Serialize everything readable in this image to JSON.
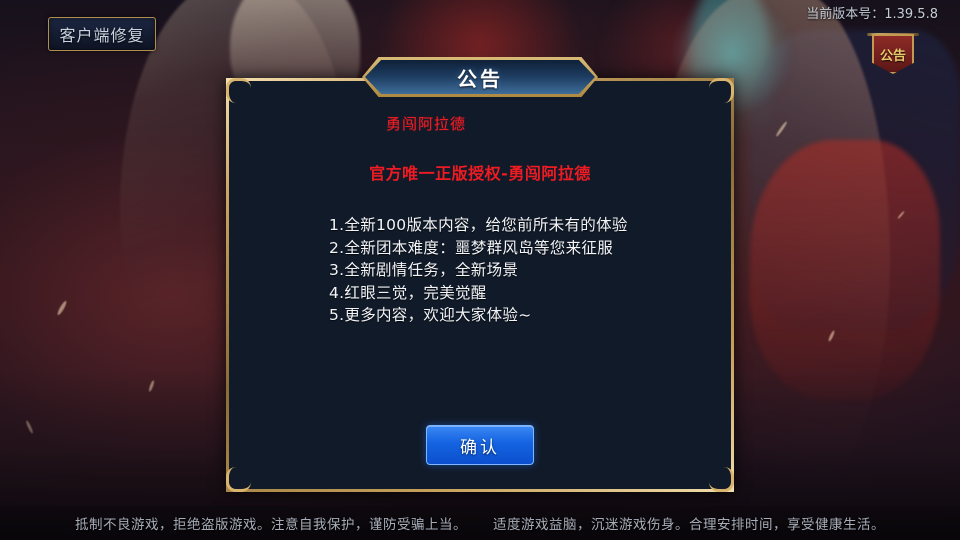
{
  "topbar": {
    "repair_button": "客户端修复",
    "version_text": "当前版本号：1.39.5.8",
    "notice_badge_label": "公告"
  },
  "dialog": {
    "title": "公告",
    "headline_1": "勇闯阿拉德",
    "headline_2": "官方唯一正版授权-勇闯阿拉德",
    "items": [
      "1.全新100版本内容，给您前所未有的体验",
      "2.全新团本难度：噩梦群风岛等您来征服",
      "3.全新剧情任务，全新场景",
      "4.红眼三觉，完美觉醒",
      "5.更多内容，欢迎大家体验~"
    ],
    "confirm_button": "确认"
  },
  "footer": {
    "left_text": "抵制不良游戏，拒绝盗版游戏。注意自我保护，谨防受骗上当。",
    "right_text": "适度游戏益脑，沉迷游戏伤身。合理安排时间，享受健康生活。"
  },
  "colors": {
    "accent_gold": "#c9a462",
    "headline_red": "#ec1c24",
    "confirm_blue": "#1463e0",
    "dialog_bg": "#111a28"
  }
}
